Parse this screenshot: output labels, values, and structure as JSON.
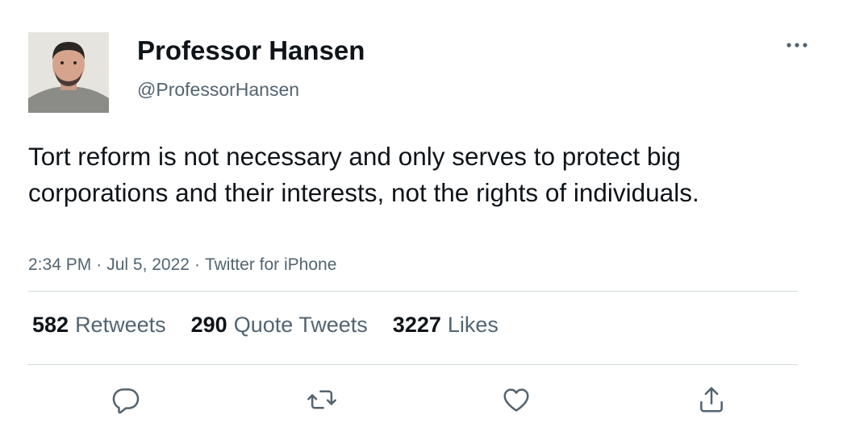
{
  "author": {
    "display_name": "Professor Hansen",
    "handle": "@ProfessorHansen",
    "avatar_icon": "user-avatar-photo"
  },
  "more_icon": "more-horizontal-icon",
  "tweet": {
    "text": "Tort reform is not necessary and only serves to protect big corporations and their interests, not the rights of individuals.",
    "time": "2:34 PM",
    "date": "Jul 5, 2022",
    "source": "Twitter for iPhone"
  },
  "stats": {
    "retweets": {
      "count": "582",
      "label": "Retweets"
    },
    "quote_tweets": {
      "count": "290",
      "label": "Quote Tweets"
    },
    "likes": {
      "count": "3227",
      "label": "Likes"
    }
  },
  "actions": {
    "reply_icon": "reply-icon",
    "retweet_icon": "retweet-icon",
    "like_icon": "heart-icon",
    "share_icon": "share-icon"
  },
  "colors": {
    "text_primary": "#0f1419",
    "text_secondary": "#536471",
    "divider": "#cfd9de"
  }
}
